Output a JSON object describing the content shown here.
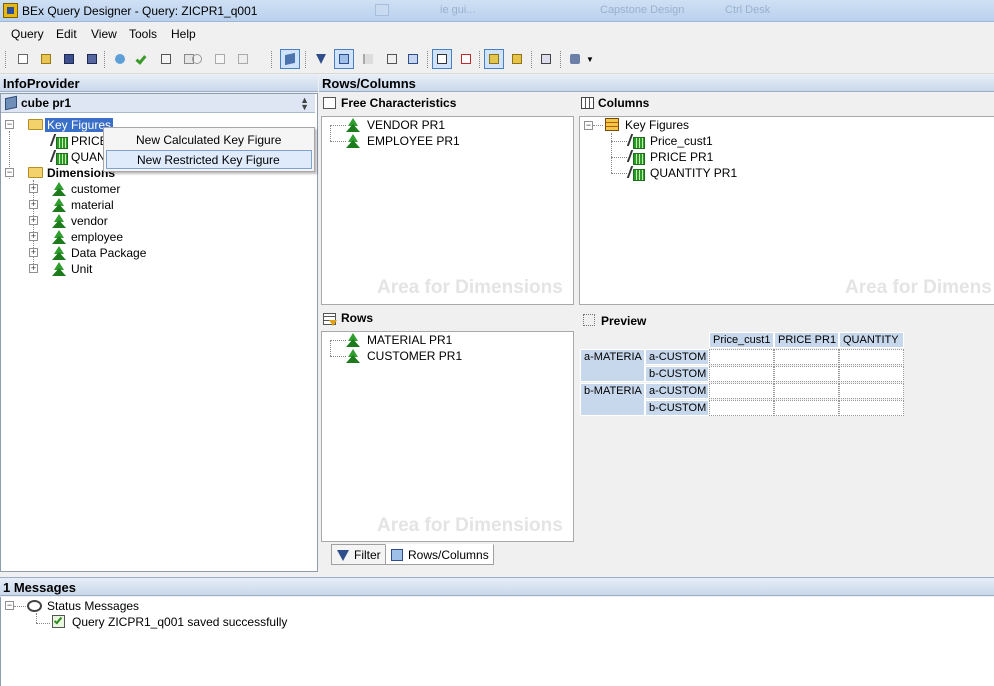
{
  "window": {
    "title": "BEx Query Designer - Query: ZICPR1_q001",
    "background_tabs": [
      "ie gui...",
      "Capstone Design",
      "Ctrl Desk"
    ]
  },
  "menu": [
    "Query",
    "Edit",
    "View",
    "Tools",
    "Help"
  ],
  "toolbar": {
    "icons": [
      "new-icon",
      "open-icon",
      "save-icon",
      "save-all-icon",
      "publish-icon",
      "check-icon",
      "properties-icon",
      "help-icon",
      "cut-icon",
      "copy-icon",
      "paste-icon",
      "infoprovider-toggle-icon",
      "filter-icon",
      "rows-columns-icon",
      "exceptions-icon",
      "conditions-icon",
      "cells-icon",
      "properties-pane-icon",
      "tasks-icon",
      "documents-icon",
      "technical-names-icon",
      "where-used-icon",
      "display-settings-icon",
      "tools-menu-icon"
    ]
  },
  "infoprovider": {
    "header": "InfoProvider",
    "cube": "cube pr1",
    "key_figures_folder": "Key Figures",
    "key_figures": [
      "PRICE",
      "QUAN"
    ],
    "dimensions_folder": "Dimensions",
    "dimensions": [
      "customer",
      "material",
      "vendor",
      "employee",
      "Data Package",
      "Unit"
    ]
  },
  "context_menu": {
    "items": [
      "New Calculated Key Figure",
      "New Restricted Key Figure"
    ]
  },
  "rows_columns": {
    "header": "Rows/Columns",
    "free_characteristics": {
      "title": "Free Characteristics",
      "items": [
        "VENDOR  PR1",
        "EMPLOYEE PR1"
      ],
      "watermark": "Area for Dimensions"
    },
    "columns": {
      "title": "Columns",
      "folder": "Key Figures",
      "items": [
        "Price_cust1",
        "PRICE PR1",
        "QUANTITY PR1"
      ],
      "watermark": "Area for Dimens"
    },
    "rows": {
      "title": "Rows",
      "items": [
        "MATERIAL PR1",
        "CUSTOMER PR1"
      ],
      "watermark": "Area for Dimensions"
    },
    "preview": {
      "title": "Preview",
      "col_headers": [
        "Price_cust1",
        "PRICE PR1",
        "QUANTITY"
      ],
      "row_groups": [
        {
          "label": "a-MATERIA",
          "rows": [
            "a-CUSTOM",
            "b-CUSTOM"
          ]
        },
        {
          "label": "b-MATERIA",
          "rows": [
            "a-CUSTOM",
            "b-CUSTOM"
          ]
        }
      ]
    },
    "tabs": [
      "Filter",
      "Rows/Columns"
    ]
  },
  "messages": {
    "header": "1 Messages",
    "group": "Status Messages",
    "items": [
      "Query ZICPR1_q001 saved successfully"
    ]
  }
}
